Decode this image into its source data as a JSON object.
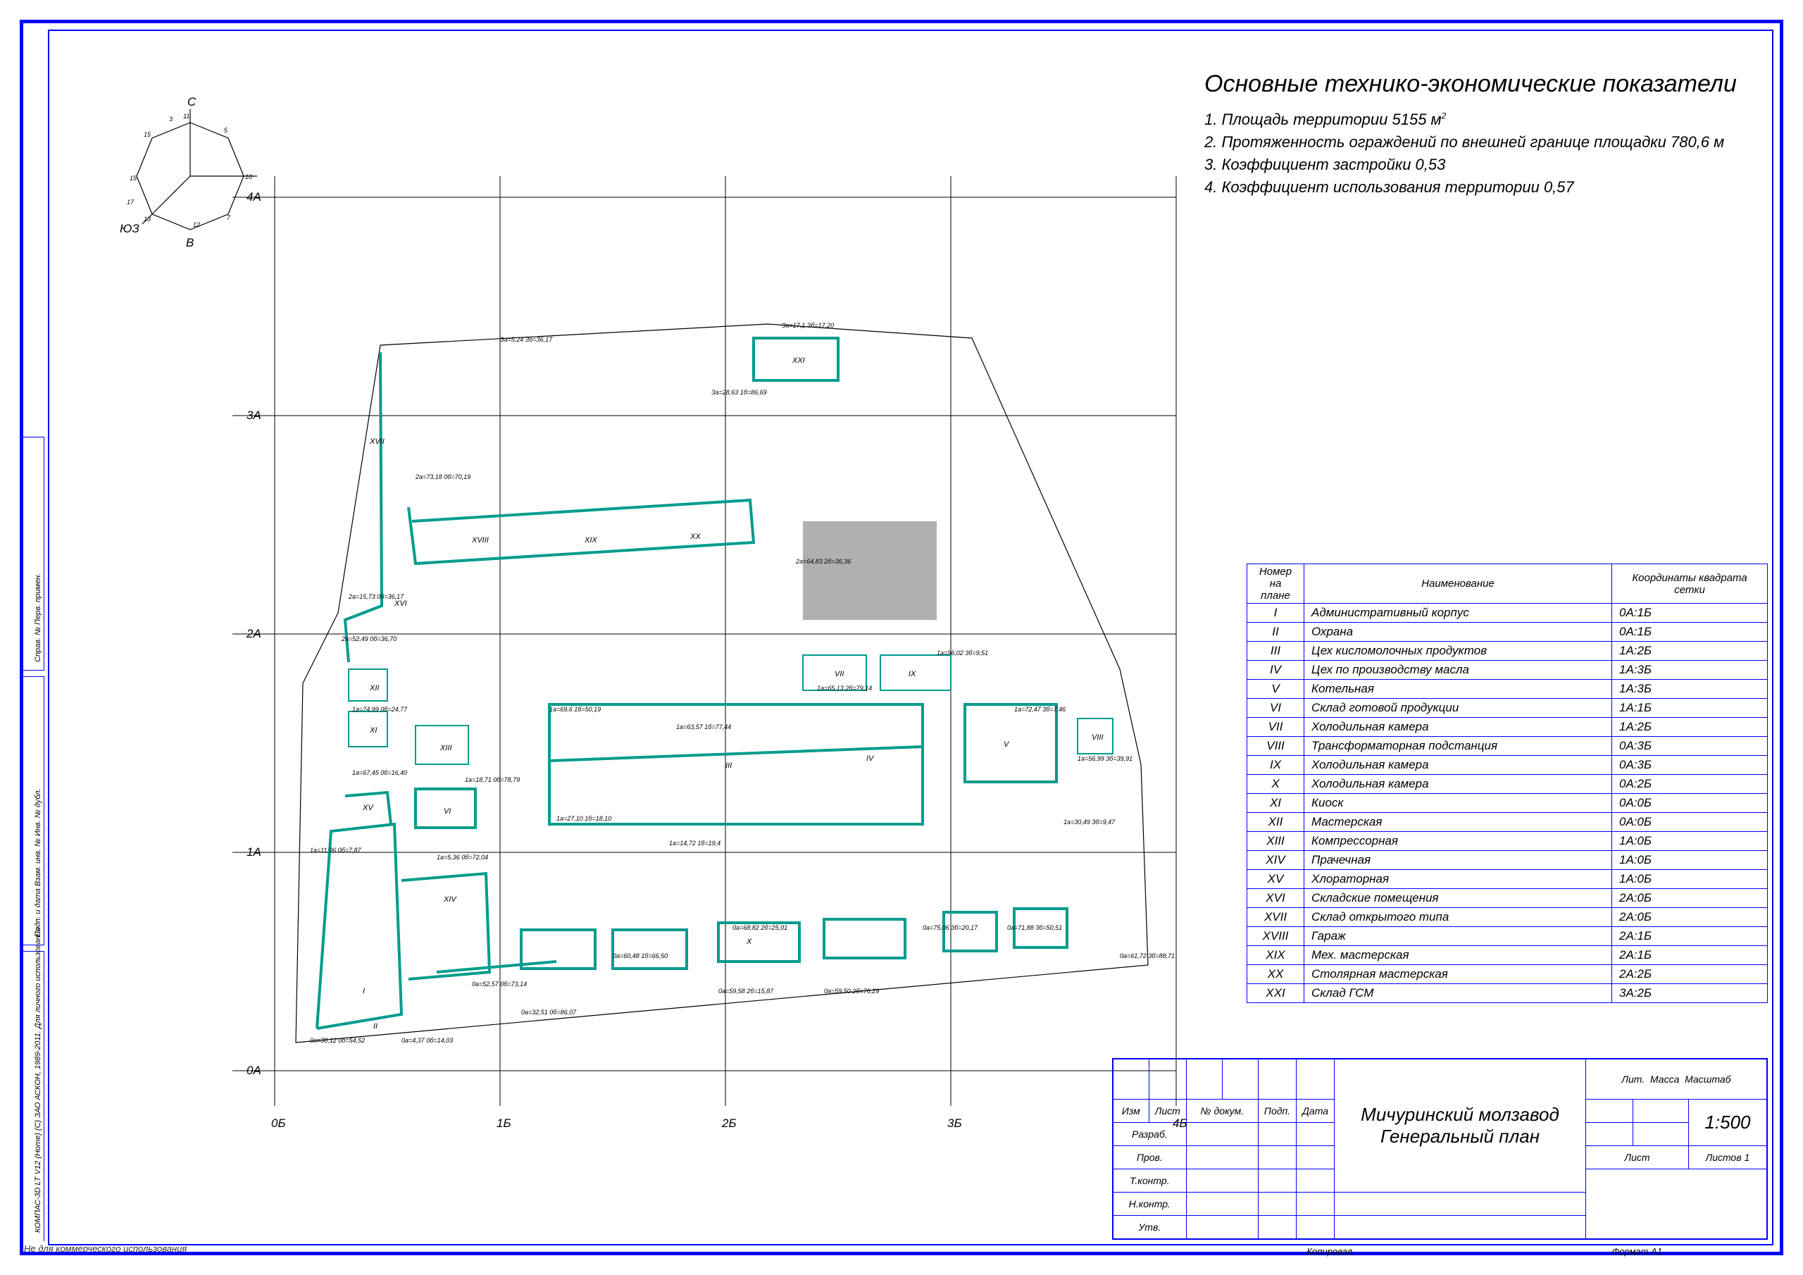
{
  "title": "Основные технико-экономические показатели",
  "indicators": {
    "i1": "1. Площадь территории  5155 м",
    "i1sup": "2",
    "i2": "2. Протяженность ограждений по внешней границе площадки 780,6 м",
    "i3": "3. Коэффициент застройки 0,53",
    "i4": "4. Коэффициент использования территории 0,57"
  },
  "axes": {
    "y": [
      "0А",
      "1А",
      "2А",
      "3А",
      "4А"
    ],
    "x": [
      "0Б",
      "1Б",
      "2Б",
      "3Б",
      "4Б"
    ]
  },
  "compass": {
    "labels": [
      "С",
      "В",
      "ЮЗ"
    ],
    "ticks": [
      "3",
      "5",
      "7",
      "10",
      "11",
      "12",
      "13",
      "15",
      "15",
      "17"
    ]
  },
  "explication": {
    "head": {
      "num": "Номер на плане",
      "name": "Наименование",
      "coord": "Координаты квадрата сетки"
    },
    "rows": [
      {
        "n": "I",
        "name": "Административный корпус",
        "c": "0А:1Б"
      },
      {
        "n": "II",
        "name": "Охрана",
        "c": "0А:1Б"
      },
      {
        "n": "III",
        "name": "Цех кисломолочных продуктов",
        "c": "1А:2Б"
      },
      {
        "n": "IV",
        "name": "Цех по производству масла",
        "c": "1А:3Б"
      },
      {
        "n": "V",
        "name": "Котельная",
        "c": "1А:3Б"
      },
      {
        "n": "VI",
        "name": "Склад готовой продукции",
        "c": "1А:1Б"
      },
      {
        "n": "VII",
        "name": "Холодильная камера",
        "c": "1А:2Б"
      },
      {
        "n": "VIII",
        "name": "Трансформаторная подстанция",
        "c": "0А:3Б"
      },
      {
        "n": "IX",
        "name": "Холодильная камера",
        "c": "0А:3Б"
      },
      {
        "n": "X",
        "name": "Холодильная камера",
        "c": "0А:2Б"
      },
      {
        "n": "XI",
        "name": "Киоск",
        "c": "0А:0Б"
      },
      {
        "n": "XII",
        "name": "Мастерская",
        "c": "0А:0Б"
      },
      {
        "n": "XIII",
        "name": "Компрессорная",
        "c": "1А:0Б"
      },
      {
        "n": "XIV",
        "name": "Прачечная",
        "c": "1А:0Б"
      },
      {
        "n": "XV",
        "name": "Хлораторная",
        "c": "1А:0Б"
      },
      {
        "n": "XVI",
        "name": "Складские помещения",
        "c": "2А:0Б"
      },
      {
        "n": "XVII",
        "name": "Склад открытого типа",
        "c": "2А:0Б"
      },
      {
        "n": "XVIII",
        "name": "Гараж",
        "c": "2А:1Б"
      },
      {
        "n": "XIX",
        "name": "Мех. мастерская",
        "c": "2А:1Б"
      },
      {
        "n": "XX",
        "name": "Столярная мастерская",
        "c": "2А:2Б"
      },
      {
        "n": "XXI",
        "name": "Склад ГСМ",
        "c": "3А:2Б"
      }
    ]
  },
  "stamp": {
    "project": "Мичуринский молзавод",
    "drawing": "Генеральный план",
    "scale": "1:500",
    "roles": [
      "Изм",
      "Лист",
      "№ докум.",
      "Подп.",
      "Дата"
    ],
    "roles2": [
      "Разраб.",
      "Пров.",
      "Т.контр.",
      "Н.контр.",
      "Утв."
    ],
    "cap": {
      "lit": "Лит.",
      "mass": "Масса",
      "msh": "Масштаб",
      "list": "Лист",
      "listov": "Листов   1"
    }
  },
  "footer": {
    "kopiroval": "Копировал",
    "format": "Формат    А1"
  },
  "watermark": "Не для коммерческого использования",
  "sidetext": "КОМПАС-3D LT V12 (Home) (С) ЗАО АСКОН, 1989-2011. Для личного использования",
  "sidetext2": "Подп. и дата     Взам. инв. №  Инв. № дубл.",
  "sidetext3": "Справ. №           Перв. примен."
}
